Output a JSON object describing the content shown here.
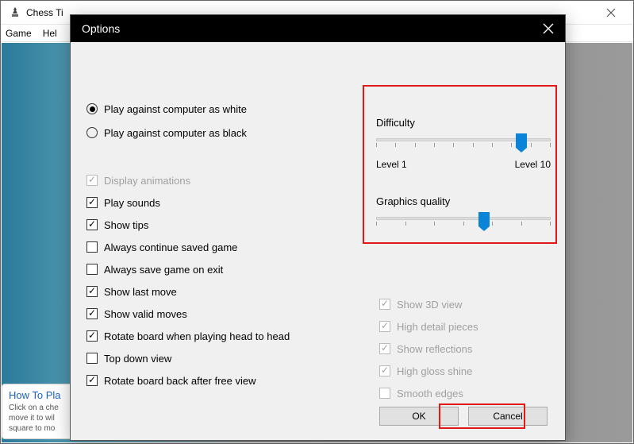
{
  "parent_window": {
    "title": "Chess Ti",
    "menu": {
      "game": "Game",
      "help": "Hel"
    }
  },
  "howto": {
    "title": "How To Pla",
    "line1": "Click on a che",
    "line2": "move it to wil",
    "line3": "square to mo"
  },
  "dialog": {
    "title": "Options",
    "radios": {
      "white": "Play against computer as white",
      "black": "Play against computer as black"
    },
    "checks": {
      "display_animations": "Display animations",
      "play_sounds": "Play sounds",
      "show_tips": "Show tips",
      "always_continue": "Always continue saved game",
      "always_save": "Always save game on exit",
      "show_last_move": "Show last move",
      "show_valid_moves": "Show valid moves",
      "rotate_h2h": "Rotate board when playing head to head",
      "top_down": "Top down view",
      "rotate_free": "Rotate board back after free view"
    },
    "difficulty": {
      "heading": "Difficulty",
      "min_label": "Level 1",
      "max_label": "Level 10",
      "value_percent": 83
    },
    "graphics": {
      "heading": "Graphics quality",
      "value_percent": 62
    },
    "gfx_checks": {
      "show_3d": "Show 3D view",
      "high_detail": "High detail pieces",
      "show_reflections": "Show reflections",
      "high_gloss": "High gloss shine",
      "smooth_edges": "Smooth edges"
    },
    "buttons": {
      "ok": "OK",
      "cancel": "Cancel"
    }
  }
}
